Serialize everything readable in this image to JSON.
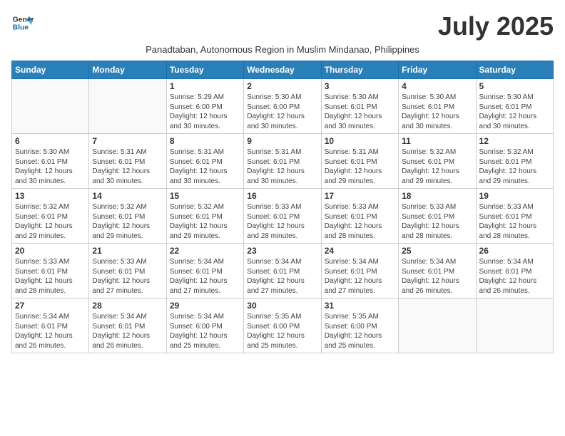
{
  "logo": {
    "line1": "General",
    "line2": "Blue"
  },
  "title": "July 2025",
  "subtitle": "Panadtaban, Autonomous Region in Muslim Mindanao, Philippines",
  "weekdays": [
    "Sunday",
    "Monday",
    "Tuesday",
    "Wednesday",
    "Thursday",
    "Friday",
    "Saturday"
  ],
  "weeks": [
    [
      {
        "day": "",
        "info": ""
      },
      {
        "day": "",
        "info": ""
      },
      {
        "day": "1",
        "info": "Sunrise: 5:29 AM\nSunset: 6:00 PM\nDaylight: 12 hours and 30 minutes."
      },
      {
        "day": "2",
        "info": "Sunrise: 5:30 AM\nSunset: 6:00 PM\nDaylight: 12 hours and 30 minutes."
      },
      {
        "day": "3",
        "info": "Sunrise: 5:30 AM\nSunset: 6:01 PM\nDaylight: 12 hours and 30 minutes."
      },
      {
        "day": "4",
        "info": "Sunrise: 5:30 AM\nSunset: 6:01 PM\nDaylight: 12 hours and 30 minutes."
      },
      {
        "day": "5",
        "info": "Sunrise: 5:30 AM\nSunset: 6:01 PM\nDaylight: 12 hours and 30 minutes."
      }
    ],
    [
      {
        "day": "6",
        "info": "Sunrise: 5:30 AM\nSunset: 6:01 PM\nDaylight: 12 hours and 30 minutes."
      },
      {
        "day": "7",
        "info": "Sunrise: 5:31 AM\nSunset: 6:01 PM\nDaylight: 12 hours and 30 minutes."
      },
      {
        "day": "8",
        "info": "Sunrise: 5:31 AM\nSunset: 6:01 PM\nDaylight: 12 hours and 30 minutes."
      },
      {
        "day": "9",
        "info": "Sunrise: 5:31 AM\nSunset: 6:01 PM\nDaylight: 12 hours and 30 minutes."
      },
      {
        "day": "10",
        "info": "Sunrise: 5:31 AM\nSunset: 6:01 PM\nDaylight: 12 hours and 29 minutes."
      },
      {
        "day": "11",
        "info": "Sunrise: 5:32 AM\nSunset: 6:01 PM\nDaylight: 12 hours and 29 minutes."
      },
      {
        "day": "12",
        "info": "Sunrise: 5:32 AM\nSunset: 6:01 PM\nDaylight: 12 hours and 29 minutes."
      }
    ],
    [
      {
        "day": "13",
        "info": "Sunrise: 5:32 AM\nSunset: 6:01 PM\nDaylight: 12 hours and 29 minutes."
      },
      {
        "day": "14",
        "info": "Sunrise: 5:32 AM\nSunset: 6:01 PM\nDaylight: 12 hours and 29 minutes."
      },
      {
        "day": "15",
        "info": "Sunrise: 5:32 AM\nSunset: 6:01 PM\nDaylight: 12 hours and 29 minutes."
      },
      {
        "day": "16",
        "info": "Sunrise: 5:33 AM\nSunset: 6:01 PM\nDaylight: 12 hours and 28 minutes."
      },
      {
        "day": "17",
        "info": "Sunrise: 5:33 AM\nSunset: 6:01 PM\nDaylight: 12 hours and 28 minutes."
      },
      {
        "day": "18",
        "info": "Sunrise: 5:33 AM\nSunset: 6:01 PM\nDaylight: 12 hours and 28 minutes."
      },
      {
        "day": "19",
        "info": "Sunrise: 5:33 AM\nSunset: 6:01 PM\nDaylight: 12 hours and 28 minutes."
      }
    ],
    [
      {
        "day": "20",
        "info": "Sunrise: 5:33 AM\nSunset: 6:01 PM\nDaylight: 12 hours and 28 minutes."
      },
      {
        "day": "21",
        "info": "Sunrise: 5:33 AM\nSunset: 6:01 PM\nDaylight: 12 hours and 27 minutes."
      },
      {
        "day": "22",
        "info": "Sunrise: 5:34 AM\nSunset: 6:01 PM\nDaylight: 12 hours and 27 minutes."
      },
      {
        "day": "23",
        "info": "Sunrise: 5:34 AM\nSunset: 6:01 PM\nDaylight: 12 hours and 27 minutes."
      },
      {
        "day": "24",
        "info": "Sunrise: 5:34 AM\nSunset: 6:01 PM\nDaylight: 12 hours and 27 minutes."
      },
      {
        "day": "25",
        "info": "Sunrise: 5:34 AM\nSunset: 6:01 PM\nDaylight: 12 hours and 26 minutes."
      },
      {
        "day": "26",
        "info": "Sunrise: 5:34 AM\nSunset: 6:01 PM\nDaylight: 12 hours and 26 minutes."
      }
    ],
    [
      {
        "day": "27",
        "info": "Sunrise: 5:34 AM\nSunset: 6:01 PM\nDaylight: 12 hours and 26 minutes."
      },
      {
        "day": "28",
        "info": "Sunrise: 5:34 AM\nSunset: 6:01 PM\nDaylight: 12 hours and 26 minutes."
      },
      {
        "day": "29",
        "info": "Sunrise: 5:34 AM\nSunset: 6:00 PM\nDaylight: 12 hours and 25 minutes."
      },
      {
        "day": "30",
        "info": "Sunrise: 5:35 AM\nSunset: 6:00 PM\nDaylight: 12 hours and 25 minutes."
      },
      {
        "day": "31",
        "info": "Sunrise: 5:35 AM\nSunset: 6:00 PM\nDaylight: 12 hours and 25 minutes."
      },
      {
        "day": "",
        "info": ""
      },
      {
        "day": "",
        "info": ""
      }
    ]
  ]
}
